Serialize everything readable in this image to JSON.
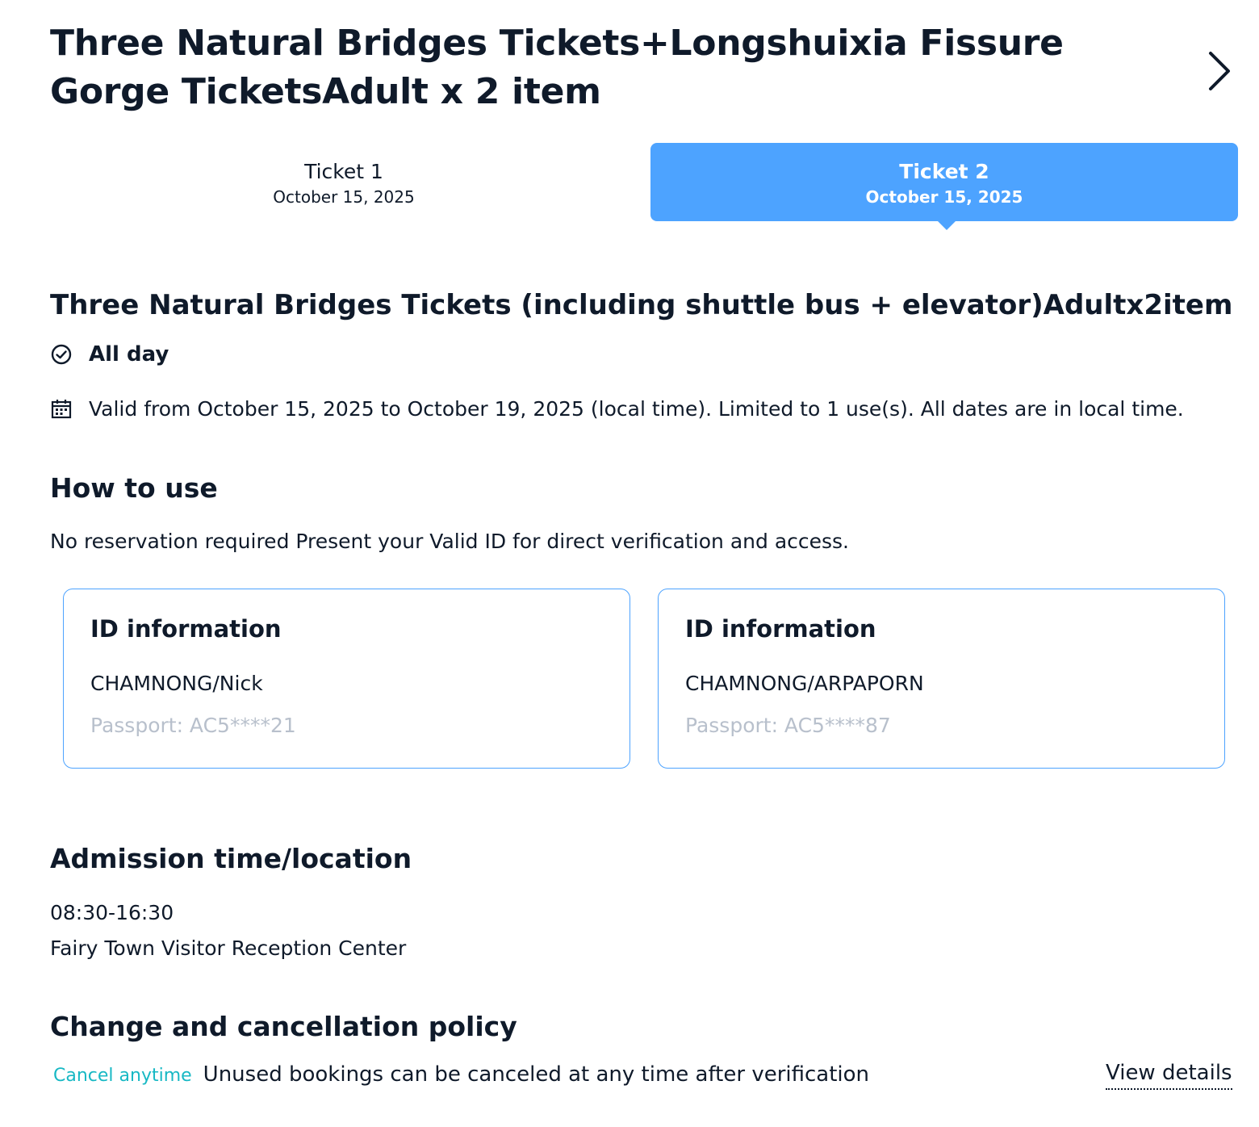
{
  "header": {
    "title": "Three Natural Bridges Tickets+Longshuixia Fissure Gorge TicketsAdult x 2 item",
    "next_icon": "chevron-right-icon"
  },
  "tabs": [
    {
      "label": "Ticket 1",
      "date": "October 15, 2025",
      "active": false
    },
    {
      "label": "Ticket 2",
      "date": "October 15, 2025",
      "active": true
    }
  ],
  "ticket": {
    "name": "Three Natural Bridges Tickets (including shuttle bus + elevator)Adultx2item",
    "all_day": "All day",
    "validity": "Valid from October 15, 2025 to October 19, 2025 (local time). Limited to 1 use(s). All dates are in local time."
  },
  "how_to_use": {
    "title": "How to use",
    "text": "No reservation required Present your Valid ID for direct verification and access."
  },
  "id_cards": [
    {
      "title": "ID information",
      "name": "CHAMNONG/Nick",
      "passport": "Passport: AC5****21"
    },
    {
      "title": "ID information",
      "name": "CHAMNONG/ARPAPORN",
      "passport": "Passport: AC5****87"
    }
  ],
  "admission": {
    "title": "Admission time/location",
    "time": "08:30-16:30",
    "location": "Fairy Town Visitor Reception Center"
  },
  "policy": {
    "title": "Change and cancellation policy",
    "tag": "Cancel anytime",
    "text": "Unused bookings can be canceled at any time after verification",
    "link": "View details"
  },
  "colors": {
    "accent": "#4da3ff",
    "tag": "#17b8c4",
    "muted": "#b8c0cc",
    "text": "#0f1a2a"
  }
}
